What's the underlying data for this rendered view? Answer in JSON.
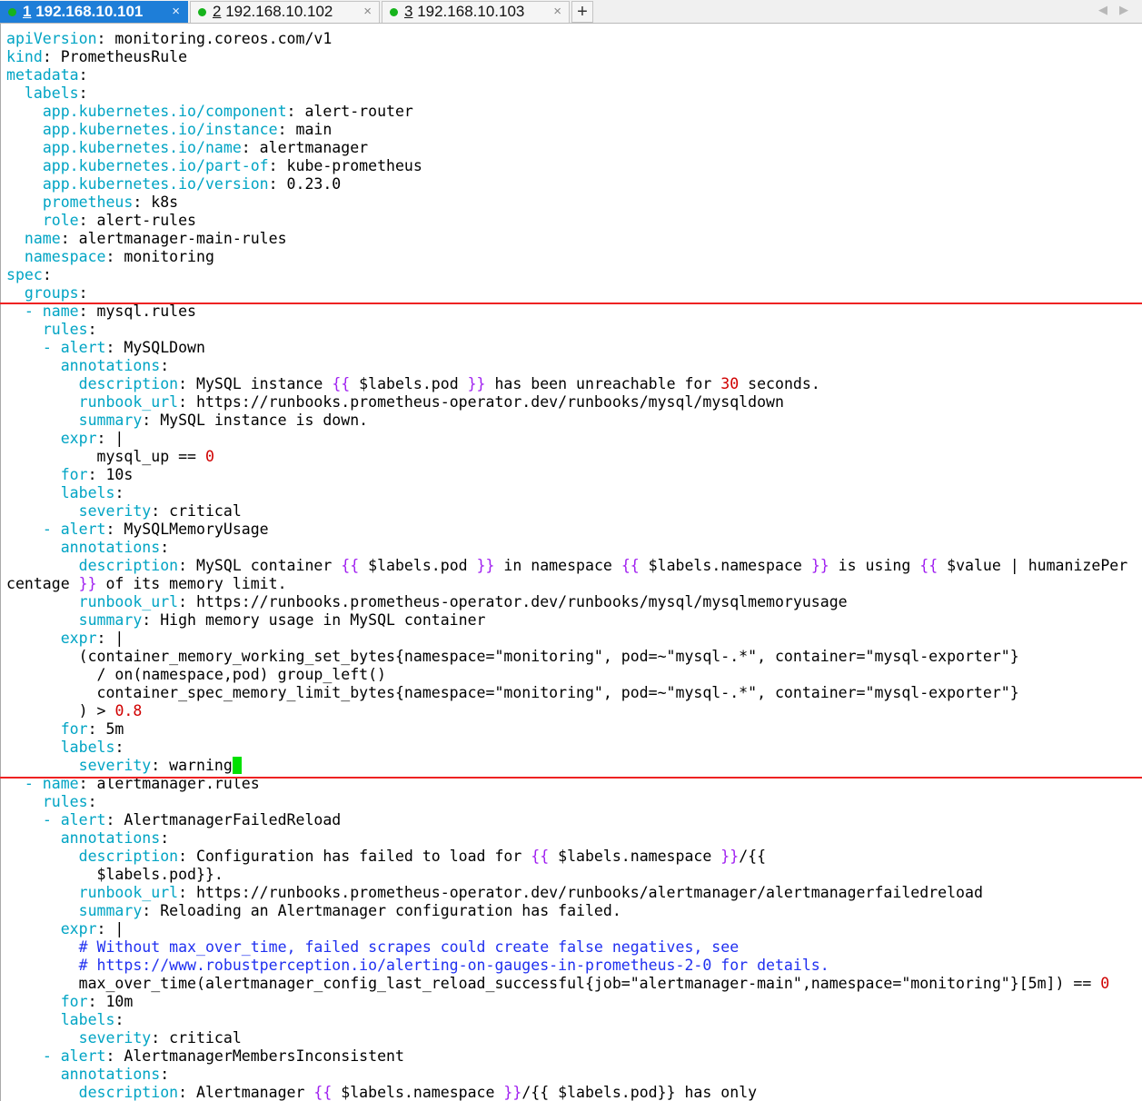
{
  "tabs": [
    {
      "index": "1",
      "host": " 192.168.10.101",
      "close": "×",
      "active": true
    },
    {
      "index": "2",
      "host": " 192.168.10.102",
      "close": "×",
      "active": false
    },
    {
      "index": "3",
      "host": " 192.168.10.103",
      "close": "×",
      "active": false
    }
  ],
  "new_tab_label": "+",
  "scroll_left": "◀",
  "scroll_right": "▶",
  "status_dot_color": "#16b31c",
  "cursor_color": "#00e000",
  "highlight_color": "#ee2222",
  "lines": [
    [
      [
        "k",
        "apiVersion"
      ],
      [
        "p",
        ": monitoring.coreos.com/v1"
      ]
    ],
    [
      [
        "k",
        "kind"
      ],
      [
        "p",
        ": PrometheusRule"
      ]
    ],
    [
      [
        "k",
        "metadata"
      ],
      [
        "p",
        ":"
      ]
    ],
    [
      [
        "p",
        "  "
      ],
      [
        "k",
        "labels"
      ],
      [
        "p",
        ":"
      ]
    ],
    [
      [
        "p",
        "    "
      ],
      [
        "k",
        "app.kubernetes.io/component"
      ],
      [
        "p",
        ": alert-router"
      ]
    ],
    [
      [
        "p",
        "    "
      ],
      [
        "k",
        "app.kubernetes.io/instance"
      ],
      [
        "p",
        ": main"
      ]
    ],
    [
      [
        "p",
        "    "
      ],
      [
        "k",
        "app.kubernetes.io/name"
      ],
      [
        "p",
        ": alertmanager"
      ]
    ],
    [
      [
        "p",
        "    "
      ],
      [
        "k",
        "app.kubernetes.io/part-of"
      ],
      [
        "p",
        ": kube-prometheus"
      ]
    ],
    [
      [
        "p",
        "    "
      ],
      [
        "k",
        "app.kubernetes.io/version"
      ],
      [
        "p",
        ": 0.23.0"
      ]
    ],
    [
      [
        "p",
        "    "
      ],
      [
        "k",
        "prometheus"
      ],
      [
        "p",
        ": k8s"
      ]
    ],
    [
      [
        "p",
        "    "
      ],
      [
        "k",
        "role"
      ],
      [
        "p",
        ": alert-rules"
      ]
    ],
    [
      [
        "p",
        "  "
      ],
      [
        "k",
        "name"
      ],
      [
        "p",
        ": alertmanager-main-rules"
      ]
    ],
    [
      [
        "p",
        "  "
      ],
      [
        "k",
        "namespace"
      ],
      [
        "p",
        ": monitoring"
      ]
    ],
    [
      [
        "k",
        "spec"
      ],
      [
        "p",
        ":"
      ]
    ],
    [
      [
        "p",
        "  "
      ],
      [
        "k",
        "groups"
      ],
      [
        "p",
        ":"
      ]
    ],
    [
      [
        "p",
        "  "
      ],
      [
        "k",
        "- name"
      ],
      [
        "p",
        ": mysql.rules"
      ]
    ],
    [
      [
        "p",
        "    "
      ],
      [
        "k",
        "rules"
      ],
      [
        "p",
        ":"
      ]
    ],
    [
      [
        "p",
        "    "
      ],
      [
        "k",
        "- alert"
      ],
      [
        "p",
        ": MySQLDown"
      ]
    ],
    [
      [
        "p",
        "      "
      ],
      [
        "k",
        "annotations"
      ],
      [
        "p",
        ":"
      ]
    ],
    [
      [
        "p",
        "        "
      ],
      [
        "k",
        "description"
      ],
      [
        "p",
        ": MySQL instance "
      ],
      [
        "s",
        "{{"
      ],
      [
        "p",
        " $labels.pod "
      ],
      [
        "s",
        "}}"
      ],
      [
        "p",
        " has been unreachable for "
      ],
      [
        "n",
        "30"
      ],
      [
        "p",
        " seconds."
      ]
    ],
    [
      [
        "p",
        "        "
      ],
      [
        "k",
        "runbook_url"
      ],
      [
        "p",
        ": https://runbooks.prometheus-operator.dev/runbooks/mysql/mysqldown"
      ]
    ],
    [
      [
        "p",
        "        "
      ],
      [
        "k",
        "summary"
      ],
      [
        "p",
        ": MySQL instance is down."
      ]
    ],
    [
      [
        "p",
        "      "
      ],
      [
        "k",
        "expr"
      ],
      [
        "p",
        ": |"
      ]
    ],
    [
      [
        "p",
        "          mysql_up == "
      ],
      [
        "n",
        "0"
      ]
    ],
    [
      [
        "p",
        "      "
      ],
      [
        "k",
        "for"
      ],
      [
        "p",
        ": 10s"
      ]
    ],
    [
      [
        "p",
        "      "
      ],
      [
        "k",
        "labels"
      ],
      [
        "p",
        ":"
      ]
    ],
    [
      [
        "p",
        "        "
      ],
      [
        "k",
        "severity"
      ],
      [
        "p",
        ": critical"
      ]
    ],
    [
      [
        "p",
        "    "
      ],
      [
        "k",
        "- alert"
      ],
      [
        "p",
        ": MySQLMemoryUsage"
      ]
    ],
    [
      [
        "p",
        "      "
      ],
      [
        "k",
        "annotations"
      ],
      [
        "p",
        ":"
      ]
    ],
    [
      [
        "p",
        "        "
      ],
      [
        "k",
        "description"
      ],
      [
        "p",
        ": MySQL container "
      ],
      [
        "s",
        "{{"
      ],
      [
        "p",
        " $labels.pod "
      ],
      [
        "s",
        "}}"
      ],
      [
        "p",
        " in namespace "
      ],
      [
        "s",
        "{{"
      ],
      [
        "p",
        " $labels.namespace "
      ],
      [
        "s",
        "}}"
      ],
      [
        "p",
        " is using "
      ],
      [
        "s",
        "{{"
      ],
      [
        "p",
        " $value | humanizePer"
      ]
    ],
    [
      [
        "p",
        "centage "
      ],
      [
        "s",
        "}}"
      ],
      [
        "p",
        " of its memory limit."
      ]
    ],
    [
      [
        "p",
        "        "
      ],
      [
        "k",
        "runbook_url"
      ],
      [
        "p",
        ": https://runbooks.prometheus-operator.dev/runbooks/mysql/mysqlmemoryusage"
      ]
    ],
    [
      [
        "p",
        "        "
      ],
      [
        "k",
        "summary"
      ],
      [
        "p",
        ": High memory usage in MySQL container"
      ]
    ],
    [
      [
        "p",
        "      "
      ],
      [
        "k",
        "expr"
      ],
      [
        "p",
        ": |"
      ]
    ],
    [
      [
        "p",
        "        (container_memory_working_set_bytes{namespace=\"monitoring\", pod=~\"mysql-.*\", container=\"mysql-exporter\"}"
      ]
    ],
    [
      [
        "p",
        "          / on(namespace,pod) group_left()"
      ]
    ],
    [
      [
        "p",
        "          container_spec_memory_limit_bytes{namespace=\"monitoring\", pod=~\"mysql-.*\", container=\"mysql-exporter\"}"
      ]
    ],
    [
      [
        "p",
        "        ) > "
      ],
      [
        "n",
        "0.8"
      ]
    ],
    [
      [
        "p",
        "      "
      ],
      [
        "k",
        "for"
      ],
      [
        "p",
        ": 5m"
      ]
    ],
    [
      [
        "p",
        "      "
      ],
      [
        "k",
        "labels"
      ],
      [
        "p",
        ":"
      ]
    ],
    [
      [
        "p",
        "        "
      ],
      [
        "k",
        "severity"
      ],
      [
        "p",
        ": warning"
      ],
      [
        "cur",
        " "
      ]
    ],
    [
      [
        "p",
        "  "
      ],
      [
        "k",
        "- name"
      ],
      [
        "p",
        ": alertmanager.rules"
      ]
    ],
    [
      [
        "p",
        "    "
      ],
      [
        "k",
        "rules"
      ],
      [
        "p",
        ":"
      ]
    ],
    [
      [
        "p",
        "    "
      ],
      [
        "k",
        "- alert"
      ],
      [
        "p",
        ": AlertmanagerFailedReload"
      ]
    ],
    [
      [
        "p",
        "      "
      ],
      [
        "k",
        "annotations"
      ],
      [
        "p",
        ":"
      ]
    ],
    [
      [
        "p",
        "        "
      ],
      [
        "k",
        "description"
      ],
      [
        "p",
        ": Configuration has failed to load for "
      ],
      [
        "s",
        "{{"
      ],
      [
        "p",
        " $labels.namespace "
      ],
      [
        "s",
        "}}"
      ],
      [
        "p",
        "/{{"
      ]
    ],
    [
      [
        "p",
        "          $labels.pod}}."
      ]
    ],
    [
      [
        "p",
        "        "
      ],
      [
        "k",
        "runbook_url"
      ],
      [
        "p",
        ": https://runbooks.prometheus-operator.dev/runbooks/alertmanager/alertmanagerfailedreload"
      ]
    ],
    [
      [
        "p",
        "        "
      ],
      [
        "k",
        "summary"
      ],
      [
        "p",
        ": Reloading an Alertmanager configuration has failed."
      ]
    ],
    [
      [
        "p",
        "      "
      ],
      [
        "k",
        "expr"
      ],
      [
        "p",
        ": |"
      ]
    ],
    [
      [
        "p",
        "        "
      ],
      [
        "c",
        "# Without max_over_time, failed scrapes could create false negatives, see"
      ]
    ],
    [
      [
        "p",
        "        "
      ],
      [
        "c",
        "# https://www.robustperception.io/alerting-on-gauges-in-prometheus-2-0 for details."
      ]
    ],
    [
      [
        "p",
        "        max_over_time(alertmanager_config_last_reload_successful{job=\"alertmanager-main\",namespace=\"monitoring\"}[5m]) == "
      ],
      [
        "n",
        "0"
      ]
    ],
    [
      [
        "p",
        "      "
      ],
      [
        "k",
        "for"
      ],
      [
        "p",
        ": 10m"
      ]
    ],
    [
      [
        "p",
        "      "
      ],
      [
        "k",
        "labels"
      ],
      [
        "p",
        ":"
      ]
    ],
    [
      [
        "p",
        "        "
      ],
      [
        "k",
        "severity"
      ],
      [
        "p",
        ": critical"
      ]
    ],
    [
      [
        "p",
        "    "
      ],
      [
        "k",
        "- alert"
      ],
      [
        "p",
        ": AlertmanagerMembersInconsistent"
      ]
    ],
    [
      [
        "p",
        "      "
      ],
      [
        "k",
        "annotations"
      ],
      [
        "p",
        ":"
      ]
    ],
    [
      [
        "p",
        "        "
      ],
      [
        "k",
        "description"
      ],
      [
        "p",
        ": Alertmanager "
      ],
      [
        "s",
        "{{"
      ],
      [
        "p",
        " $labels.namespace "
      ],
      [
        "s",
        "}}"
      ],
      [
        "p",
        "/{{ $labels.pod}} has only"
      ]
    ]
  ]
}
